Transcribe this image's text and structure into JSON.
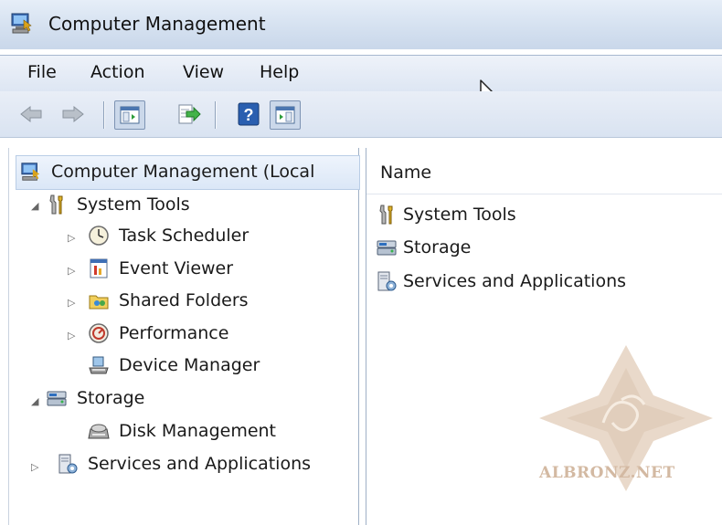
{
  "window": {
    "title": "Computer Management"
  },
  "menu": [
    "File",
    "Action",
    "View",
    "Help"
  ],
  "toolbar": {
    "buttons": [
      "back-arrow-icon",
      "forward-arrow-icon",
      "show-hide-console-tree-icon",
      "export-list-icon",
      "help-icon",
      "show-hide-action-pane-icon"
    ]
  },
  "tree": {
    "root": "Computer Management (Local",
    "system_tools": "System Tools",
    "task_scheduler": "Task Scheduler",
    "event_viewer": "Event Viewer",
    "shared_folders": "Shared Folders",
    "performance": "Performance",
    "device_manager": "Device Manager",
    "storage": "Storage",
    "disk_management": "Disk Management",
    "services_apps": "Services and Applications"
  },
  "list": {
    "column_name": "Name",
    "items": [
      "System Tools",
      "Storage",
      "Services and Applications"
    ]
  },
  "watermark": {
    "text": "ALBRONZ.NET"
  },
  "colors": {
    "titlebar": "#d5e1f0",
    "selection": "#dbe7f7",
    "watermark": "#d3b9a2"
  }
}
